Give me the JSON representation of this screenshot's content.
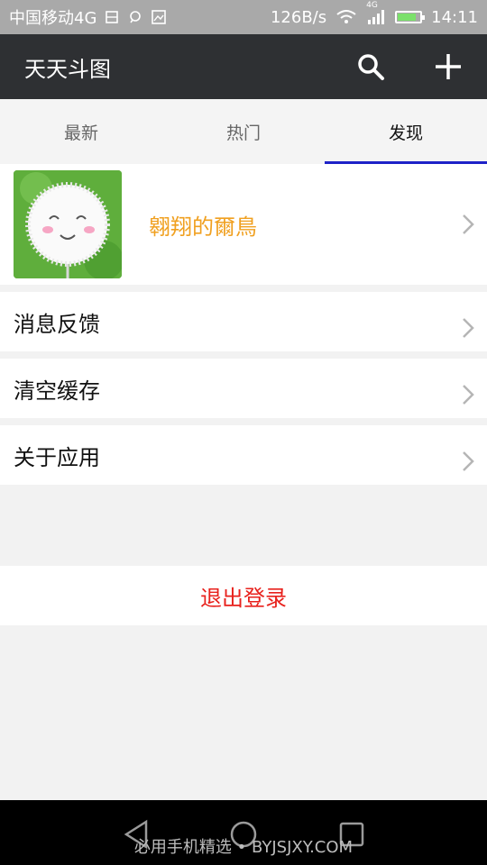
{
  "status_bar": {
    "carrier": "中国移动4G",
    "network_speed": "126B/s",
    "signal_label": "4G",
    "time": "14:11"
  },
  "app_bar": {
    "title": "天天斗图",
    "icons": [
      "search-icon",
      "add-icon"
    ]
  },
  "tabs": [
    {
      "label": "最新",
      "active": false
    },
    {
      "label": "热门",
      "active": false
    },
    {
      "label": "发现",
      "active": true
    }
  ],
  "profile": {
    "name": "翱翔的爾鳥"
  },
  "menu": [
    {
      "label": "消息反馈"
    },
    {
      "label": "清空缓存"
    },
    {
      "label": "关于应用"
    }
  ],
  "logout": {
    "label": "退出登录"
  },
  "watermark": "必用手机精选 • BYJSJXY.COM",
  "colors": {
    "app_bar": "#2e3033",
    "tab_indicator": "#1f22c8",
    "profile_name": "#f0a020",
    "logout": "#e8211c"
  }
}
